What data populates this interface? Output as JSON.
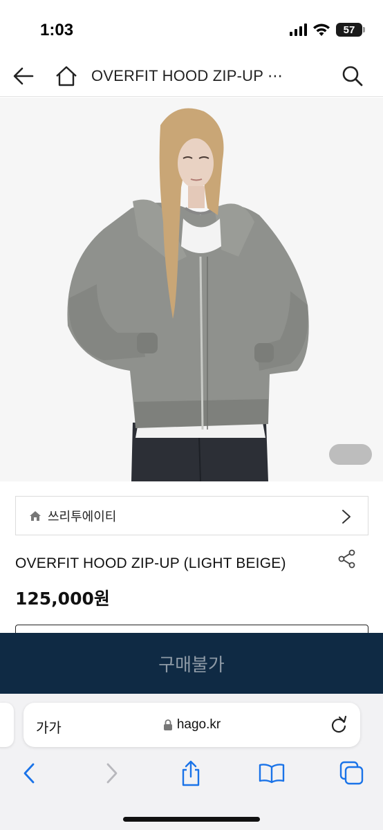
{
  "status_bar": {
    "time": "1:03",
    "battery": "57"
  },
  "header": {
    "title": "OVERFIT HOOD ZIP-UP ⋯"
  },
  "brand": {
    "name": "쓰리투에이티"
  },
  "product": {
    "name": "OVERFIT HOOD ZIP-UP (LIGHT BEIGE)",
    "price": "125,000원"
  },
  "buy_button": {
    "label": "구매불가"
  },
  "browser": {
    "text_size_label": "가가",
    "url": "hago.kr"
  },
  "colors": {
    "buy_bar": "#0f2a44",
    "buy_label": "#8e9aa6",
    "safari_blue": "#1a73e8"
  }
}
